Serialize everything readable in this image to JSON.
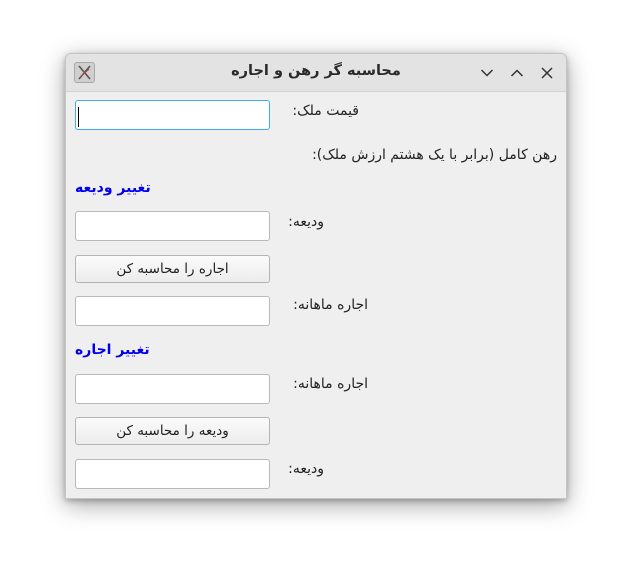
{
  "window": {
    "title": "محاسبه گر رهن و اجاره"
  },
  "form": {
    "price_label": "قیمت ملک:",
    "price_value": "",
    "full_mortgage_label": "رهن کامل (برابر با یک هشتم ارزش ملک):"
  },
  "section_deposit": {
    "heading": "تغییر ودیعه",
    "deposit_label": "ودیعه:",
    "deposit_value": "",
    "calc_button": "اجاره را محاسبه کن",
    "rent_label": "اجاره ماهانه:",
    "rent_value": ""
  },
  "section_rent": {
    "heading": "تغییر اجاره",
    "rent_label": "اجاره ماهانه:",
    "rent_value": "",
    "calc_button": "ودیعه را محاسبه کن",
    "deposit_label": "ودیعه:",
    "deposit_value": ""
  },
  "colors": {
    "section_heading": "#0000ee",
    "focus_border": "#3daee9"
  },
  "icons": {
    "app": "app-icon",
    "minimize": "chevron-down-icon",
    "maximize": "chevron-up-icon",
    "close": "close-icon"
  }
}
